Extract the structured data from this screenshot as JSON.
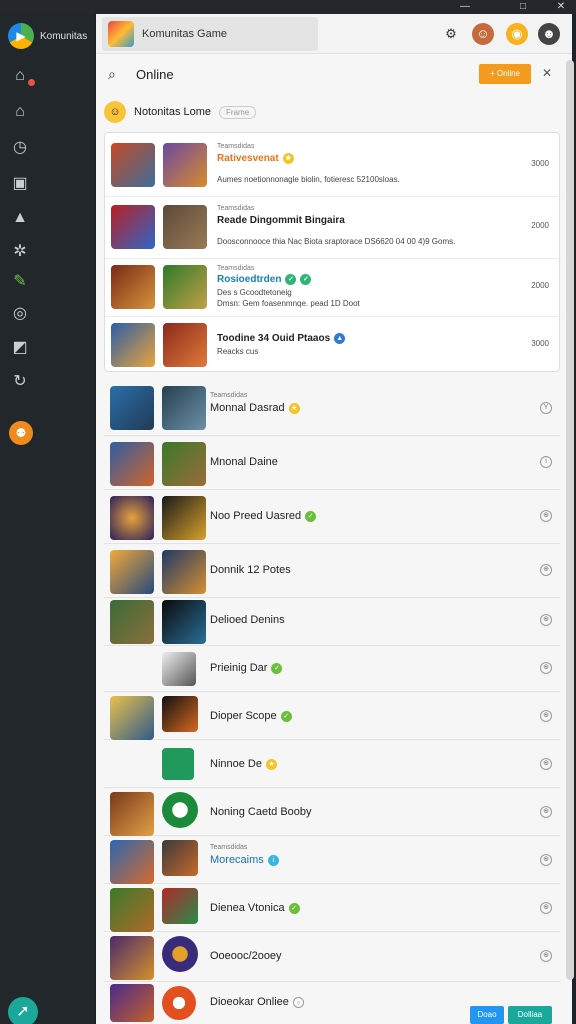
{
  "window": {
    "title": "Komunitas",
    "min": "—",
    "max": "□",
    "close": "✕"
  },
  "colors": {
    "accent": "#f39b1f",
    "rail": "#22272c",
    "teal": "#1aa89a",
    "blue": "#2196f3"
  },
  "tab": {
    "title": "Komunitas Game"
  },
  "search": {
    "label": "Online",
    "button": "+ Online",
    "close": "✕"
  },
  "subheader": {
    "title": "Notonitas Lome",
    "chip": "Frame"
  },
  "featured": [
    {
      "small": "Teamsdidas",
      "title": "Rativesvenat",
      "desc": "Aumes noetionnonagle biolin, fotieresc 52100sloas.",
      "value": "3000",
      "title_color": "#e8751a"
    },
    {
      "small": "Teamsdidas",
      "title": "Reade Dingommit Bingaira",
      "desc": "Doosconnooce thia Nac Biota sraptorace DS6620 04 00 4)9 Goms.",
      "value": "2000",
      "title_color": "#111"
    },
    {
      "small": "Teamsdidas",
      "title": "Rosioedtrden",
      "desc": "Dmsn: Gem foasenmnqe. pead 1D Doot",
      "value": "2000",
      "title_color": "#1a7fb5",
      "sub": "Des s Gcoodtetoneig"
    },
    {
      "small": "",
      "title": "Toodine 34 Ouid Ptaaos",
      "desc": "Reacks cus",
      "value": "3000",
      "title_color": "#111"
    }
  ],
  "list": [
    {
      "small": "Teamsdidas",
      "title": "Monnal Dasrad",
      "badge": "star"
    },
    {
      "small": "",
      "title": "Mnonal Daine",
      "badge": ""
    },
    {
      "small": "",
      "title": "Noo Preed Uasred",
      "badge": "check"
    },
    {
      "small": "",
      "title": "Donnik 12 Potes",
      "badge": ""
    },
    {
      "small": "",
      "title": "Delioed Denins",
      "badge": ""
    },
    {
      "small": "",
      "title": "Prieinig Dar",
      "badge": "check"
    },
    {
      "small": "",
      "title": "Dioper Scope",
      "badge": "check"
    },
    {
      "small": "",
      "title": "Ninnoe De",
      "badge": "star"
    },
    {
      "small": "",
      "title": "Noning Caetd Booby",
      "badge": ""
    },
    {
      "small": "Teamsdidas",
      "title": "Morecaims",
      "badge": "info"
    },
    {
      "small": "",
      "title": "Dienea Vtonica",
      "badge": "check"
    },
    {
      "small": "",
      "title": "Ooeooc/2ooey",
      "badge": ""
    },
    {
      "small": "",
      "title": "Dioeokar Onliee",
      "badge": "ring"
    }
  ],
  "bottom": {
    "btn1": "Doao",
    "btn2": "Dolliaa"
  }
}
